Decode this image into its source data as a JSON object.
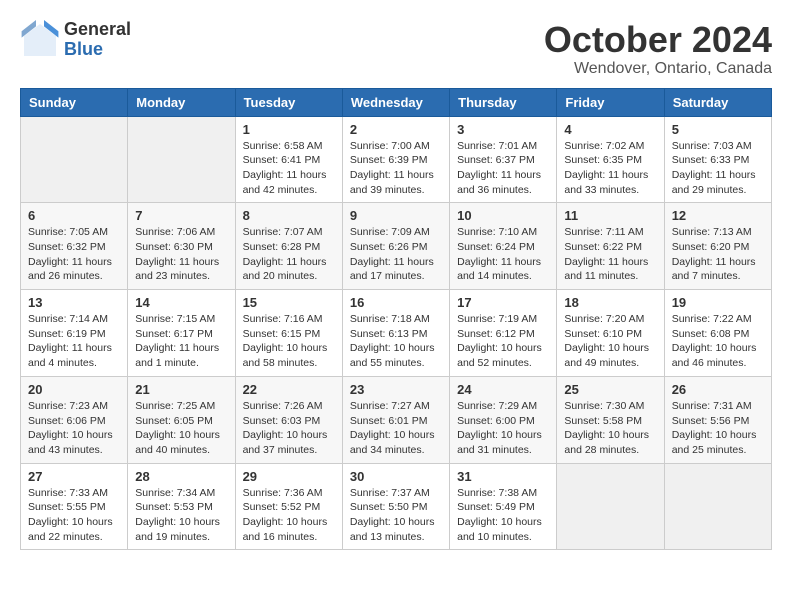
{
  "header": {
    "logo_general": "General",
    "logo_blue": "Blue",
    "month_title": "October 2024",
    "location": "Wendover, Ontario, Canada"
  },
  "days_of_week": [
    "Sunday",
    "Monday",
    "Tuesday",
    "Wednesday",
    "Thursday",
    "Friday",
    "Saturday"
  ],
  "weeks": [
    [
      {
        "day": "",
        "empty": true
      },
      {
        "day": "",
        "empty": true
      },
      {
        "day": "1",
        "sunrise": "Sunrise: 6:58 AM",
        "sunset": "Sunset: 6:41 PM",
        "daylight": "Daylight: 11 hours and 42 minutes."
      },
      {
        "day": "2",
        "sunrise": "Sunrise: 7:00 AM",
        "sunset": "Sunset: 6:39 PM",
        "daylight": "Daylight: 11 hours and 39 minutes."
      },
      {
        "day": "3",
        "sunrise": "Sunrise: 7:01 AM",
        "sunset": "Sunset: 6:37 PM",
        "daylight": "Daylight: 11 hours and 36 minutes."
      },
      {
        "day": "4",
        "sunrise": "Sunrise: 7:02 AM",
        "sunset": "Sunset: 6:35 PM",
        "daylight": "Daylight: 11 hours and 33 minutes."
      },
      {
        "day": "5",
        "sunrise": "Sunrise: 7:03 AM",
        "sunset": "Sunset: 6:33 PM",
        "daylight": "Daylight: 11 hours and 29 minutes."
      }
    ],
    [
      {
        "day": "6",
        "sunrise": "Sunrise: 7:05 AM",
        "sunset": "Sunset: 6:32 PM",
        "daylight": "Daylight: 11 hours and 26 minutes."
      },
      {
        "day": "7",
        "sunrise": "Sunrise: 7:06 AM",
        "sunset": "Sunset: 6:30 PM",
        "daylight": "Daylight: 11 hours and 23 minutes."
      },
      {
        "day": "8",
        "sunrise": "Sunrise: 7:07 AM",
        "sunset": "Sunset: 6:28 PM",
        "daylight": "Daylight: 11 hours and 20 minutes."
      },
      {
        "day": "9",
        "sunrise": "Sunrise: 7:09 AM",
        "sunset": "Sunset: 6:26 PM",
        "daylight": "Daylight: 11 hours and 17 minutes."
      },
      {
        "day": "10",
        "sunrise": "Sunrise: 7:10 AM",
        "sunset": "Sunset: 6:24 PM",
        "daylight": "Daylight: 11 hours and 14 minutes."
      },
      {
        "day": "11",
        "sunrise": "Sunrise: 7:11 AM",
        "sunset": "Sunset: 6:22 PM",
        "daylight": "Daylight: 11 hours and 11 minutes."
      },
      {
        "day": "12",
        "sunrise": "Sunrise: 7:13 AM",
        "sunset": "Sunset: 6:20 PM",
        "daylight": "Daylight: 11 hours and 7 minutes."
      }
    ],
    [
      {
        "day": "13",
        "sunrise": "Sunrise: 7:14 AM",
        "sunset": "Sunset: 6:19 PM",
        "daylight": "Daylight: 11 hours and 4 minutes."
      },
      {
        "day": "14",
        "sunrise": "Sunrise: 7:15 AM",
        "sunset": "Sunset: 6:17 PM",
        "daylight": "Daylight: 11 hours and 1 minute."
      },
      {
        "day": "15",
        "sunrise": "Sunrise: 7:16 AM",
        "sunset": "Sunset: 6:15 PM",
        "daylight": "Daylight: 10 hours and 58 minutes."
      },
      {
        "day": "16",
        "sunrise": "Sunrise: 7:18 AM",
        "sunset": "Sunset: 6:13 PM",
        "daylight": "Daylight: 10 hours and 55 minutes."
      },
      {
        "day": "17",
        "sunrise": "Sunrise: 7:19 AM",
        "sunset": "Sunset: 6:12 PM",
        "daylight": "Daylight: 10 hours and 52 minutes."
      },
      {
        "day": "18",
        "sunrise": "Sunrise: 7:20 AM",
        "sunset": "Sunset: 6:10 PM",
        "daylight": "Daylight: 10 hours and 49 minutes."
      },
      {
        "day": "19",
        "sunrise": "Sunrise: 7:22 AM",
        "sunset": "Sunset: 6:08 PM",
        "daylight": "Daylight: 10 hours and 46 minutes."
      }
    ],
    [
      {
        "day": "20",
        "sunrise": "Sunrise: 7:23 AM",
        "sunset": "Sunset: 6:06 PM",
        "daylight": "Daylight: 10 hours and 43 minutes."
      },
      {
        "day": "21",
        "sunrise": "Sunrise: 7:25 AM",
        "sunset": "Sunset: 6:05 PM",
        "daylight": "Daylight: 10 hours and 40 minutes."
      },
      {
        "day": "22",
        "sunrise": "Sunrise: 7:26 AM",
        "sunset": "Sunset: 6:03 PM",
        "daylight": "Daylight: 10 hours and 37 minutes."
      },
      {
        "day": "23",
        "sunrise": "Sunrise: 7:27 AM",
        "sunset": "Sunset: 6:01 PM",
        "daylight": "Daylight: 10 hours and 34 minutes."
      },
      {
        "day": "24",
        "sunrise": "Sunrise: 7:29 AM",
        "sunset": "Sunset: 6:00 PM",
        "daylight": "Daylight: 10 hours and 31 minutes."
      },
      {
        "day": "25",
        "sunrise": "Sunrise: 7:30 AM",
        "sunset": "Sunset: 5:58 PM",
        "daylight": "Daylight: 10 hours and 28 minutes."
      },
      {
        "day": "26",
        "sunrise": "Sunrise: 7:31 AM",
        "sunset": "Sunset: 5:56 PM",
        "daylight": "Daylight: 10 hours and 25 minutes."
      }
    ],
    [
      {
        "day": "27",
        "sunrise": "Sunrise: 7:33 AM",
        "sunset": "Sunset: 5:55 PM",
        "daylight": "Daylight: 10 hours and 22 minutes."
      },
      {
        "day": "28",
        "sunrise": "Sunrise: 7:34 AM",
        "sunset": "Sunset: 5:53 PM",
        "daylight": "Daylight: 10 hours and 19 minutes."
      },
      {
        "day": "29",
        "sunrise": "Sunrise: 7:36 AM",
        "sunset": "Sunset: 5:52 PM",
        "daylight": "Daylight: 10 hours and 16 minutes."
      },
      {
        "day": "30",
        "sunrise": "Sunrise: 7:37 AM",
        "sunset": "Sunset: 5:50 PM",
        "daylight": "Daylight: 10 hours and 13 minutes."
      },
      {
        "day": "31",
        "sunrise": "Sunrise: 7:38 AM",
        "sunset": "Sunset: 5:49 PM",
        "daylight": "Daylight: 10 hours and 10 minutes."
      },
      {
        "day": "",
        "empty": true
      },
      {
        "day": "",
        "empty": true
      }
    ]
  ]
}
